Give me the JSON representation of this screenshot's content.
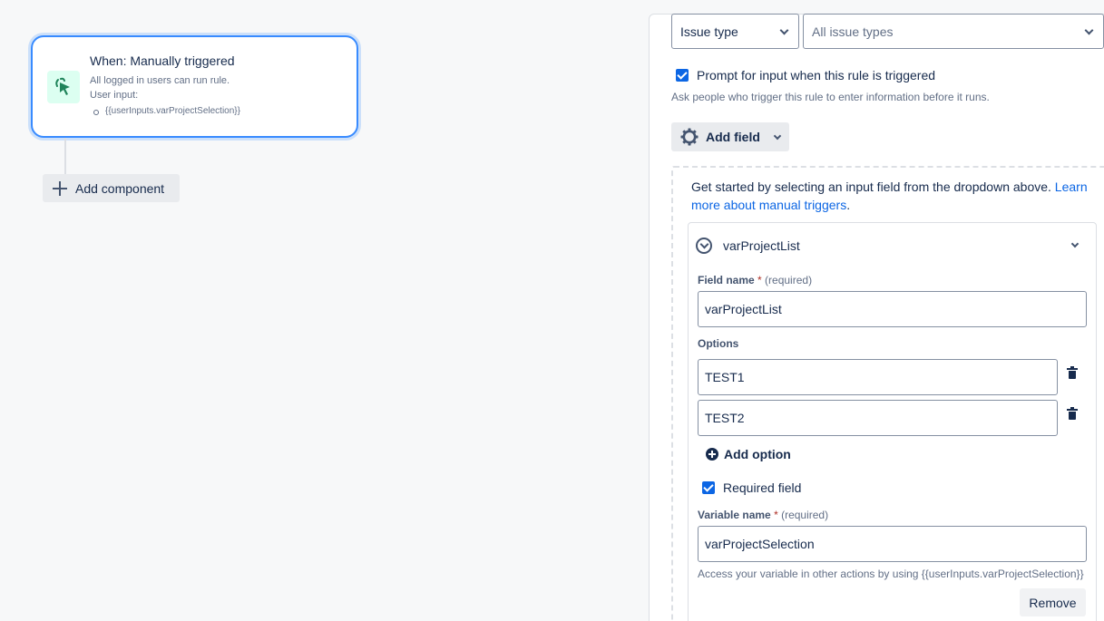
{
  "trigger": {
    "title": "When: Manually triggered",
    "line1": "All logged in users can run rule.",
    "line2": "User input:",
    "input_item": "{{userInputs.varProjectSelection}}"
  },
  "canvas": {
    "add_component_label": "Add component"
  },
  "panel": {
    "issue_type_select": "Issue type",
    "issue_types_select": "All issue types",
    "prompt_label": "Prompt for input when this rule is triggered",
    "prompt_checked": true,
    "prompt_help": "Ask people who trigger this rule to enter information before it runs.",
    "add_field_label": "Add field",
    "get_started_text": "Get started by selecting an input field from the dropdown above.",
    "learn_more_link": "Learn more about manual triggers",
    "learn_more_suffix": ".",
    "field_card": {
      "title": "varProjectList",
      "field_name_label": "Field name",
      "required_star": "*",
      "required_text": "(required)",
      "field_name_value": "varProjectList",
      "options_label": "Options",
      "options": [
        "TEST1",
        "TEST2"
      ],
      "add_option_label": "Add option",
      "required_field_label": "Required field",
      "required_field_checked": true,
      "variable_name_label": "Variable name",
      "variable_name_value": "varProjectSelection",
      "access_help": "Access your variable in other actions by using {{userInputs.varProjectSelection}}",
      "remove_label": "Remove"
    }
  },
  "icons": {
    "trigger_icon": "cursor-click-icon",
    "settings_icon": "gear-icon",
    "delete_icon": "trash-icon",
    "collapse_icon": "chevron-down-circle-icon"
  },
  "colors": {
    "accent": "#0c66e4",
    "trigger_border": "#388bff",
    "trigger_icon_bg": "#dcfff1",
    "trigger_icon_fg": "#1f845a"
  }
}
